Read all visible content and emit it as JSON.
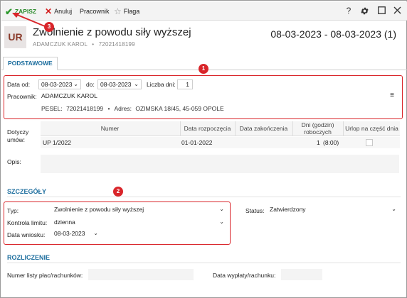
{
  "toolbar": {
    "save_label": "ZAPISZ",
    "cancel_label": "Anuluj",
    "worker_label": "Pracownik",
    "flag_label": "Flaga",
    "help_glyph": "?"
  },
  "header": {
    "badge": "UR",
    "title": "Zwolnienie z powodu siły wyższej",
    "subtitle": "ADAMCZUK KAROL",
    "subtitle_id": "72021418199",
    "subtitle_sep": "•",
    "date_range": "08-03-2023 - 08-03-2023 (1)"
  },
  "tabs": [
    {
      "label": "PODSTAWOWE"
    }
  ],
  "basic": {
    "date_from_label": "Data od:",
    "date_from": "08-03-2023",
    "date_to_label": "do:",
    "date_to": "08-03-2023",
    "days_label": "Liczba dni:",
    "days": "1",
    "worker_label": "Pracownik:",
    "worker": "ADAMCZUK KAROL",
    "worker_menu_glyph": "≡",
    "pesel_label": "PESEL:",
    "pesel": "72021418199",
    "address_sep": "•",
    "address_label": "Adres:",
    "address": "OZIMSKA 18/45, 45-059 OPOLE"
  },
  "contracts": {
    "label": "Dotyczy umów:",
    "columns": [
      "Numer",
      "Data rozpoczęcia",
      "Data zakończenia",
      "Dni (godzin) roboczych",
      "Urlop na część dnia"
    ],
    "rows": [
      {
        "number": "UP 1/2022",
        "start": "01-01-2022",
        "end": "",
        "days": "1",
        "hours": "(8:00)",
        "partial": false
      }
    ]
  },
  "notes": {
    "label": "Opis:",
    "value": ""
  },
  "details": {
    "section_title": "SZCZEGÓŁY",
    "type_label": "Typ:",
    "type_value": "Zwolnienie z powodu siły wyższej",
    "limit_label": "Kontrola limitu:",
    "limit_value": "dzienna",
    "request_date_label": "Data wniosku:",
    "request_date": "08-03-2023",
    "status_label": "Status:",
    "status_value": "Zatwierdzony"
  },
  "settlement": {
    "section_title": "ROZLICZENIE",
    "payroll_label": "Numer listy płac/rachunków:",
    "payroll_value": "",
    "payout_date_label": "Data wypłaty/rachunku:",
    "payout_date_value": ""
  },
  "annotations": [
    "1",
    "2",
    "3"
  ],
  "colors": {
    "accent": "#1d6e9e",
    "save_green": "#2e9a2e",
    "annotation_red": "#d9252a",
    "badge_text": "#8a3a2a"
  },
  "icons": {
    "save": "check-icon",
    "cancel": "x-icon",
    "flag": "star-icon",
    "help": "question-icon",
    "settings": "gear-icon",
    "maximize": "maximize-icon",
    "close": "close-icon"
  }
}
